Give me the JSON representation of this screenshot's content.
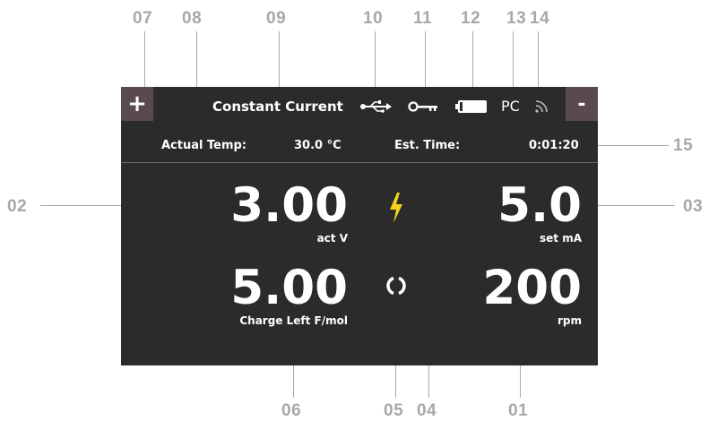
{
  "callouts": {
    "c07": "07",
    "c08": "08",
    "c09": "09",
    "c10": "10",
    "c11": "11",
    "c12": "12",
    "c13": "13",
    "c14": "14",
    "c15": "15",
    "c02": "02",
    "c03": "03",
    "c06": "06",
    "c05": "05",
    "c04": "04",
    "c01": "01"
  },
  "screen": {
    "plus_label": "+",
    "minus_label": "-",
    "mode": "Constant Current",
    "pc_label": "PC",
    "actual_temp_label": "Actual Temp:",
    "actual_temp_value": "30.0 °C",
    "est_time_label": "Est. Time:",
    "est_time_value": "0:01:20",
    "voltage_value": "3.00",
    "voltage_unit": "act V",
    "current_value": "5.0",
    "current_unit": "set mA",
    "charge_value": "5.00",
    "charge_unit": "Charge Left F/mol",
    "speed_value": "200",
    "speed_unit": "rpm"
  },
  "icons": [
    "usb-icon",
    "key-icon",
    "battery-icon",
    "wireless-icon",
    "lightning-icon",
    "rotation-icon"
  ],
  "colors": {
    "screen_bg": "#2b2b2b",
    "button_bg": "#5b4a4d",
    "accent": "#f2d21c",
    "callout": "#a8a8a8"
  }
}
